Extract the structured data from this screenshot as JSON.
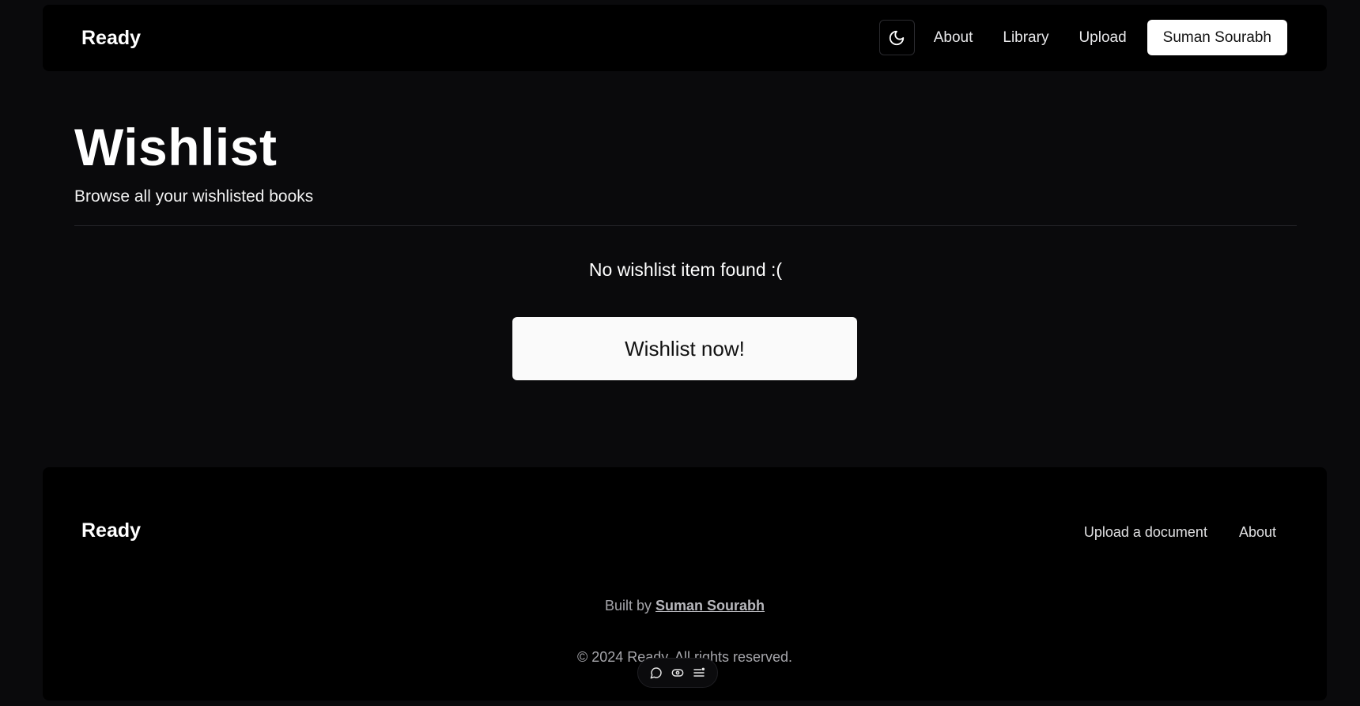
{
  "navbar": {
    "brand": "Ready",
    "links": [
      "About",
      "Library",
      "Upload"
    ],
    "user_name": "Suman Sourabh",
    "theme_icon": "moon-icon"
  },
  "main": {
    "title": "Wishlist",
    "subtitle": "Browse all your wishlisted books",
    "empty_message": "No wishlist item found :(",
    "cta_label": "Wishlist now!"
  },
  "footer": {
    "brand": "Ready",
    "links": [
      "Upload a document",
      "About"
    ],
    "built_by_prefix": "Built by",
    "author": "Suman Sourabh",
    "copyright": "© 2024 Ready. All rights reserved."
  },
  "toolbar": {
    "icons": [
      "comment-icon",
      "toggle-icon",
      "list-icon"
    ]
  },
  "colors": {
    "background": "#0a0a0c",
    "surface": "#000000",
    "button_light": "#fafafa",
    "text_primary": "#ffffff",
    "text_muted": "#a6a6ab"
  }
}
